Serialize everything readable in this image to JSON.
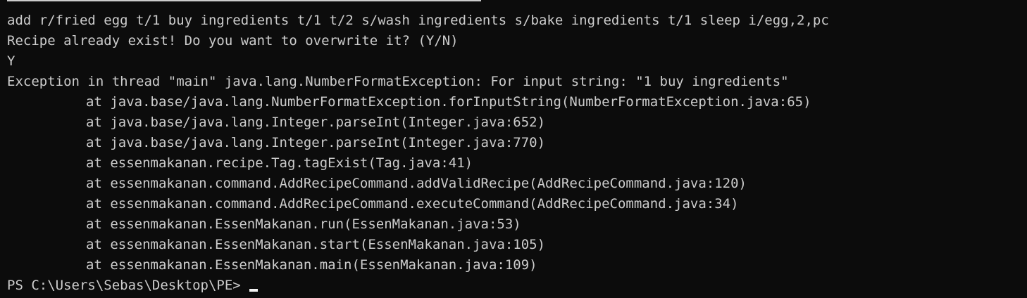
{
  "terminal": {
    "command": "add r/fried egg t/1 buy ingredients t/1 t/2 s/wash ingredients s/bake ingredients t/1 sleep i/egg,2,pc",
    "overwrite_prompt": "Recipe already exist! Do you want to overwrite it? (Y/N)",
    "user_answer": "Y",
    "exception_message": "Exception in thread \"main\" java.lang.NumberFormatException: For input string: \"1 buy ingredients\"",
    "stack_trace": [
      "at java.base/java.lang.NumberFormatException.forInputString(NumberFormatException.java:65)",
      "at java.base/java.lang.Integer.parseInt(Integer.java:652)",
      "at java.base/java.lang.Integer.parseInt(Integer.java:770)",
      "at essenmakanan.recipe.Tag.tagExist(Tag.java:41)",
      "at essenmakanan.command.AddRecipeCommand.addValidRecipe(AddRecipeCommand.java:120)",
      "at essenmakanan.command.AddRecipeCommand.executeCommand(AddRecipeCommand.java:34)",
      "at essenmakanan.EssenMakanan.run(EssenMakanan.java:53)",
      "at essenmakanan.EssenMakanan.start(EssenMakanan.java:105)",
      "at essenmakanan.EssenMakanan.main(EssenMakanan.java:109)"
    ],
    "prompt": "PS C:\\Users\\Sebas\\Desktop\\PE>"
  },
  "colors": {
    "background": "#0c0c0c",
    "text": "#cccccc",
    "cursor": "#f2f2f2"
  }
}
